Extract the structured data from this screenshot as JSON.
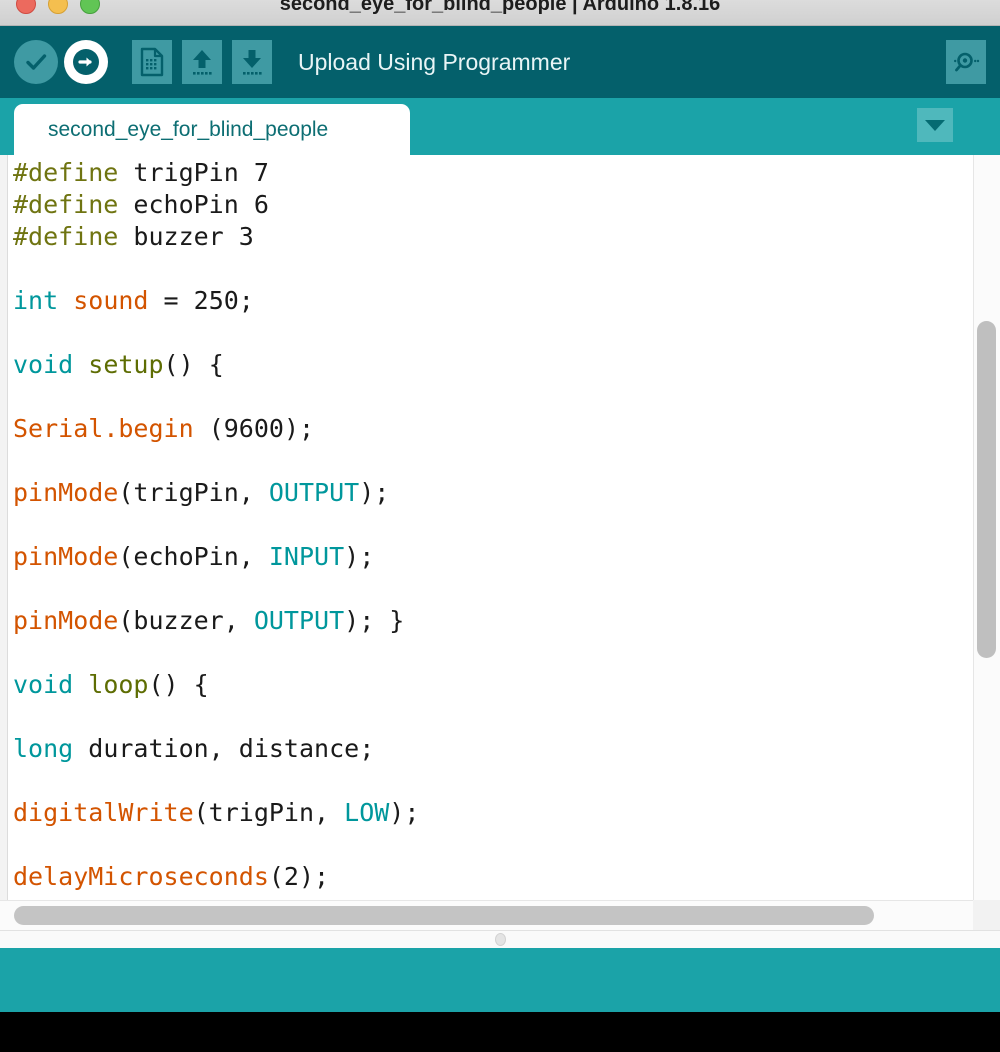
{
  "window": {
    "title": "second_eye_for_blind_people | Arduino 1.8.16",
    "controls": {
      "close": "close-button",
      "minimize": "minimize-button",
      "zoom": "zoom-button"
    }
  },
  "toolbar": {
    "verify_label": "Verify",
    "upload_label": "Upload",
    "new_label": "New",
    "open_label": "Open",
    "save_label": "Save",
    "action_text": "Upload Using Programmer",
    "serial_monitor_label": "Serial Monitor",
    "colors": {
      "background": "#04606b",
      "button": "#3f9aa3",
      "button_active": "#ffffff"
    }
  },
  "tabs": {
    "items": [
      {
        "label": "second_eye_for_blind_people",
        "active": true
      }
    ],
    "menu_label": "Tab menu",
    "bar_color": "#1ba3a8"
  },
  "editor": {
    "lines": [
      [
        {
          "t": "#define",
          "c": "pre"
        },
        {
          "t": " trigPin 7",
          "c": "txt"
        }
      ],
      [
        {
          "t": "#define",
          "c": "pre"
        },
        {
          "t": " echoPin 6",
          "c": "txt"
        }
      ],
      [
        {
          "t": "#define",
          "c": "pre"
        },
        {
          "t": " buzzer 3",
          "c": "txt"
        }
      ],
      [],
      [
        {
          "t": "int",
          "c": "type"
        },
        {
          "t": " ",
          "c": "txt"
        },
        {
          "t": "sound",
          "c": "fn"
        },
        {
          "t": " = 250;",
          "c": "txt"
        }
      ],
      [],
      [
        {
          "t": "void",
          "c": "type"
        },
        {
          "t": " ",
          "c": "txt"
        },
        {
          "t": "setup",
          "c": "name"
        },
        {
          "t": "() {",
          "c": "txt"
        }
      ],
      [],
      [
        {
          "t": "Serial",
          "c": "fn"
        },
        {
          "t": ".",
          "c": "fn"
        },
        {
          "t": "begin",
          "c": "fn"
        },
        {
          "t": " (9600);",
          "c": "txt"
        }
      ],
      [],
      [
        {
          "t": "pinMode",
          "c": "fn"
        },
        {
          "t": "(trigPin, ",
          "c": "txt"
        },
        {
          "t": "OUTPUT",
          "c": "type"
        },
        {
          "t": ");",
          "c": "txt"
        }
      ],
      [],
      [
        {
          "t": "pinMode",
          "c": "fn"
        },
        {
          "t": "(echoPin, ",
          "c": "txt"
        },
        {
          "t": "INPUT",
          "c": "type"
        },
        {
          "t": ");",
          "c": "txt"
        }
      ],
      [],
      [
        {
          "t": "pinMode",
          "c": "fn"
        },
        {
          "t": "(buzzer, ",
          "c": "txt"
        },
        {
          "t": "OUTPUT",
          "c": "type"
        },
        {
          "t": "); }",
          "c": "txt"
        }
      ],
      [],
      [
        {
          "t": "void",
          "c": "type"
        },
        {
          "t": " ",
          "c": "txt"
        },
        {
          "t": "loop",
          "c": "name"
        },
        {
          "t": "() {",
          "c": "txt"
        }
      ],
      [],
      [
        {
          "t": "long",
          "c": "type"
        },
        {
          "t": " duration, distance;",
          "c": "txt"
        }
      ],
      [],
      [
        {
          "t": "digitalWrite",
          "c": "fn"
        },
        {
          "t": "(trigPin, ",
          "c": "txt"
        },
        {
          "t": "LOW",
          "c": "type"
        },
        {
          "t": ");",
          "c": "txt"
        }
      ],
      [],
      [
        {
          "t": "delayMicroseconds",
          "c": "fn"
        },
        {
          "t": "(2);",
          "c": "txt"
        }
      ]
    ],
    "syntax_colors": {
      "preprocessor": "#6f7411",
      "keyword_type": "#00979c",
      "function": "#d35400",
      "function_name": "#5e6d03",
      "plain": "#1a1a1a"
    }
  },
  "scrollbars": {
    "vertical_label": "Vertical scrollbar",
    "horizontal_label": "Horizontal scrollbar"
  },
  "splitter": {
    "label": "Editor console splitter"
  },
  "status": {
    "text": "",
    "color": "#1ba3a8"
  },
  "console": {
    "text": ""
  }
}
